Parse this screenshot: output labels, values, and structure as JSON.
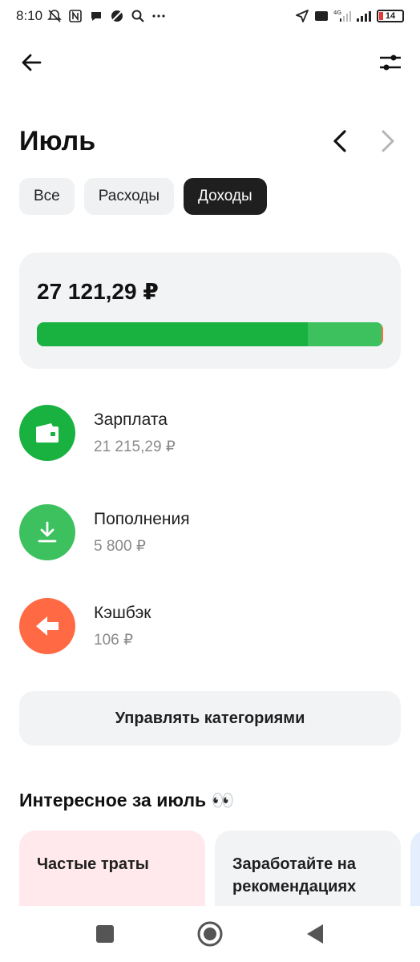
{
  "status_bar": {
    "time": "8:10",
    "battery": "14",
    "network": "4G"
  },
  "header": {
    "month": "Июль"
  },
  "segments": [
    {
      "label": "Все",
      "active": false
    },
    {
      "label": "Расходы",
      "active": false
    },
    {
      "label": "Доходы",
      "active": true
    }
  ],
  "summary": {
    "total": "27 121,29 ₽",
    "bar_fractions": [
      {
        "category": "Зарплата",
        "fraction": 0.782,
        "color": "#19b241"
      },
      {
        "category": "Пополнения",
        "fraction": 0.214,
        "color": "#3cc15e"
      },
      {
        "category": "Кэшбэк",
        "fraction": 0.004,
        "color": "#ff6a44"
      }
    ]
  },
  "categories": [
    {
      "name": "Зарплата",
      "amount": "21 215,29 ₽",
      "icon": "wallet-icon",
      "color": "#19b241"
    },
    {
      "name": "Пополнения",
      "amount": "5 800 ₽",
      "icon": "download-icon",
      "color": "#3cc15e"
    },
    {
      "name": "Кэшбэк",
      "amount": "106 ₽",
      "icon": "arrow-left-icon",
      "color": "#ff6a44"
    }
  ],
  "manage_button": "Управлять категориями",
  "interesting": {
    "title": "Интересное за июль 👀",
    "cards": [
      {
        "title": "Частые траты",
        "color": "#ffe9ec"
      },
      {
        "title": "Заработайте на рекомендациях",
        "color": "#f2f3f5"
      }
    ]
  }
}
